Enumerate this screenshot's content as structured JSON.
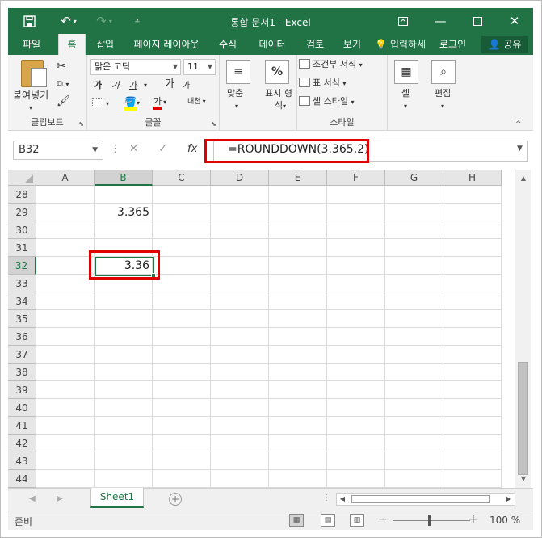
{
  "title_bar": {
    "title": "통합 문서1 - Excel",
    "save_icon": "save-icon",
    "undo_icon": "undo-icon",
    "redo_icon": "redo-icon",
    "customize_icon": "customize-quick-access-icon"
  },
  "tabs": [
    "파일",
    "홈",
    "삽입",
    "페이지 레이아웃",
    "수식",
    "데이터",
    "검토",
    "보기"
  ],
  "active_tab": "홈",
  "tell_me": "입력하세",
  "login": "로그인",
  "share": "공유",
  "ribbon": {
    "clipboard": {
      "paste": "붙여넣기",
      "label": "클립보드"
    },
    "font": {
      "font_name": "맑은 고딕",
      "font_size": "11",
      "bold": "가",
      "italic": "가",
      "underline": "가",
      "grow": "가",
      "shrink": "가",
      "font_color": "가",
      "phonetic": "내천",
      "label": "글꼴"
    },
    "alignment": {
      "label": "맞춤"
    },
    "number": {
      "label": "표시 형식",
      "symbol": "%"
    },
    "styles": {
      "conditional": "조건부 서식",
      "table": "표 서식",
      "cell_styles": "셀 스타일",
      "label": "스타일"
    },
    "cells": {
      "label": "셀"
    },
    "editing": {
      "label": "편집"
    }
  },
  "formula_bar": {
    "name_box": "B32",
    "formula": "=ROUNDDOWN(3.365,2)",
    "fx": "fx"
  },
  "columns": [
    "A",
    "B",
    "C",
    "D",
    "E",
    "F",
    "G",
    "H"
  ],
  "selected_column": "B",
  "rows": [
    "28",
    "29",
    "30",
    "31",
    "32",
    "33",
    "34",
    "35",
    "36",
    "37",
    "38",
    "39",
    "40",
    "41",
    "42",
    "43",
    "44"
  ],
  "selected_row": "32",
  "cells": {
    "B29": "3.365",
    "B32": "3.36"
  },
  "sheet_tab": "Sheet1",
  "status": {
    "ready": "준비",
    "zoom": "100 %"
  },
  "colors": {
    "accent": "#217346",
    "highlight_box": "#e00000"
  }
}
